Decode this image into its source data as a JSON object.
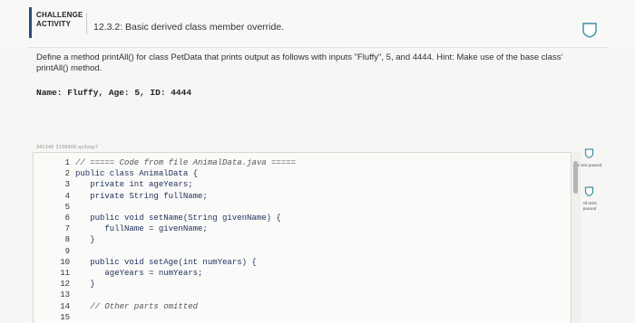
{
  "header": {
    "badge_line1": "CHALLENGE",
    "badge_line2": "ACTIVITY",
    "title": "12.3.2: Basic derived class member override."
  },
  "prompt": {
    "text": "Define a method printAll() for class PetData that prints output as follows with inputs \"Fluffy\", 5, and 4444. Hint: Make use of the base class' printAll() method.",
    "sample_output": "Name: Fluffy, Age: 5, ID: 4444"
  },
  "editor": {
    "id_label": "341340 2198900.qx3zqy7",
    "lines": [
      {
        "n": "1",
        "code": "// ===== Code from file AnimalData.java =====",
        "comment": true
      },
      {
        "n": "2",
        "code": "public class AnimalData {",
        "comment": false
      },
      {
        "n": "3",
        "code": "   private int ageYears;",
        "comment": false
      },
      {
        "n": "4",
        "code": "   private String fullName;",
        "comment": false
      },
      {
        "n": "5",
        "code": "",
        "comment": false
      },
      {
        "n": "6",
        "code": "   public void setName(String givenName) {",
        "comment": false
      },
      {
        "n": "7",
        "code": "      fullName = givenName;",
        "comment": false
      },
      {
        "n": "8",
        "code": "   }",
        "comment": false
      },
      {
        "n": "9",
        "code": "",
        "comment": false
      },
      {
        "n": "10",
        "code": "   public void setAge(int numYears) {",
        "comment": false
      },
      {
        "n": "11",
        "code": "      ageYears = numYears;",
        "comment": false
      },
      {
        "n": "12",
        "code": "   }",
        "comment": false
      },
      {
        "n": "13",
        "code": "",
        "comment": false
      },
      {
        "n": "14",
        "code": "   // Other parts omitted",
        "comment": true
      },
      {
        "n": "15",
        "code": "",
        "comment": false
      }
    ]
  },
  "tests": {
    "first": "1 test passed",
    "all": "All tests passed"
  },
  "colors": {
    "accent": "#2b4d7e",
    "status_teal": "#3a8fa0"
  },
  "icons": [
    "shield-icon",
    "test-status-icon"
  ]
}
